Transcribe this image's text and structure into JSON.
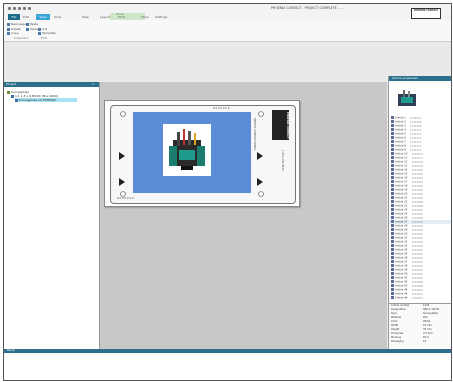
{
  "window": {
    "title": "PHOENIX CONTACT - PROJECT COMPLETE - ..."
  },
  "logo": {
    "brand": "PHOENIX CONTACT"
  },
  "ribbon_context": {
    "label": "Tools"
  },
  "tabs": [
    "File",
    "Edit",
    "View",
    "Tools",
    "Help",
    "Layout",
    "Print",
    "Shop",
    "Settings"
  ],
  "ribbon": {
    "commands": [
      "New page",
      "Paste",
      "Delete",
      "Open",
      "Cut",
      "Copy",
      "Template"
    ],
    "groups": [
      "Clipboard",
      "Edit"
    ]
  },
  "project_panel": {
    "title": "Project",
    "close": "×",
    "items": [
      {
        "label": "Surveyplate"
      },
      {
        "label": "1:1 1.5 x 9 BOOK (Box 4600)"
      },
      {
        "label": "Surveyplate 10 PHOENIX"
      }
    ]
  },
  "plate": {
    "brand": "PHOENIX CONTACT",
    "side_text": "SKETCH CONTACT PANEL",
    "side_text2": "1 800 234 5634",
    "top_marks": "0 0 0 0 0 0 0",
    "bottom_marks": "0 0 0 0 0 0 0"
  },
  "right_panel": {
    "title": "Article properties",
    "items": [
      {
        "name": "Article 1",
        "value": "1234567"
      },
      {
        "name": "Article 2",
        "value": "1234568"
      },
      {
        "name": "Article 3",
        "value": "1234569"
      },
      {
        "name": "Article 4",
        "value": "1234570"
      },
      {
        "name": "Article 5",
        "value": "1234571"
      },
      {
        "name": "Article 6",
        "value": "1234572"
      },
      {
        "name": "Article 7",
        "value": "1234573"
      },
      {
        "name": "Article 8",
        "value": "1234574"
      },
      {
        "name": "Article 9",
        "value": "1234575"
      },
      {
        "name": "Article 10",
        "value": "1234576"
      },
      {
        "name": "Article 11",
        "value": "1234577"
      },
      {
        "name": "Article 12",
        "value": "1234578"
      },
      {
        "name": "Article 13",
        "value": "1234579"
      },
      {
        "name": "Article 14",
        "value": "1234580"
      },
      {
        "name": "Article 15",
        "value": "1234581"
      },
      {
        "name": "Article 16",
        "value": "1234582"
      },
      {
        "name": "Article 17",
        "value": "1234583"
      },
      {
        "name": "Article 18",
        "value": "1234584"
      },
      {
        "name": "Article 19",
        "value": "1234585"
      },
      {
        "name": "Article 20",
        "value": "1234586"
      },
      {
        "name": "Article 21",
        "value": "1234587"
      },
      {
        "name": "Article 22",
        "value": "1234588"
      },
      {
        "name": "Article 23",
        "value": "1234589"
      },
      {
        "name": "Article 24",
        "value": "1234590"
      },
      {
        "name": "Article 25",
        "value": "1234591"
      },
      {
        "name": "Article 26",
        "value": "1234592"
      },
      {
        "name": "Article 27",
        "value": "1234593"
      },
      {
        "name": "Article 28",
        "value": "1234594"
      },
      {
        "name": "Article 29",
        "value": "1234595"
      },
      {
        "name": "Article 30",
        "value": "1234596"
      },
      {
        "name": "Article 31",
        "value": "1234597"
      },
      {
        "name": "Article 32",
        "value": "1234598"
      },
      {
        "name": "Article 33",
        "value": "1234599"
      },
      {
        "name": "Article 34",
        "value": "1234600"
      },
      {
        "name": "Article 35",
        "value": "1234601"
      },
      {
        "name": "Article 36",
        "value": "1234602"
      },
      {
        "name": "Article 37",
        "value": "1234603"
      },
      {
        "name": "Article 38",
        "value": "1234604"
      },
      {
        "name": "Article 39",
        "value": "1234605"
      },
      {
        "name": "Article 40",
        "value": "1234606"
      },
      {
        "name": "Article 41",
        "value": "1234607"
      },
      {
        "name": "Article 42",
        "value": "1234608"
      },
      {
        "name": "Article 43",
        "value": "1234609"
      },
      {
        "name": "Article 44",
        "value": "1234610"
      },
      {
        "name": "Article 45",
        "value": "1234611"
      },
      {
        "name": "Article 46",
        "value": "1234612"
      }
    ],
    "properties": [
      {
        "k": "Article number",
        "v": "1234"
      },
      {
        "k": "Designation",
        "v": "SBS-A 19X35"
      },
      {
        "k": "Type",
        "v": "Surveyplate"
      },
      {
        "k": "Material",
        "v": "PVC"
      },
      {
        "k": "Color",
        "v": "White"
      },
      {
        "k": "Width",
        "v": "19 mm"
      },
      {
        "k": "Height",
        "v": "35 mm"
      },
      {
        "k": "Thickness",
        "v": "0.5 mm"
      },
      {
        "k": "Marking",
        "v": "Print"
      },
      {
        "k": "Packaging",
        "v": "10"
      }
    ]
  },
  "status": {
    "text": "Ready"
  }
}
